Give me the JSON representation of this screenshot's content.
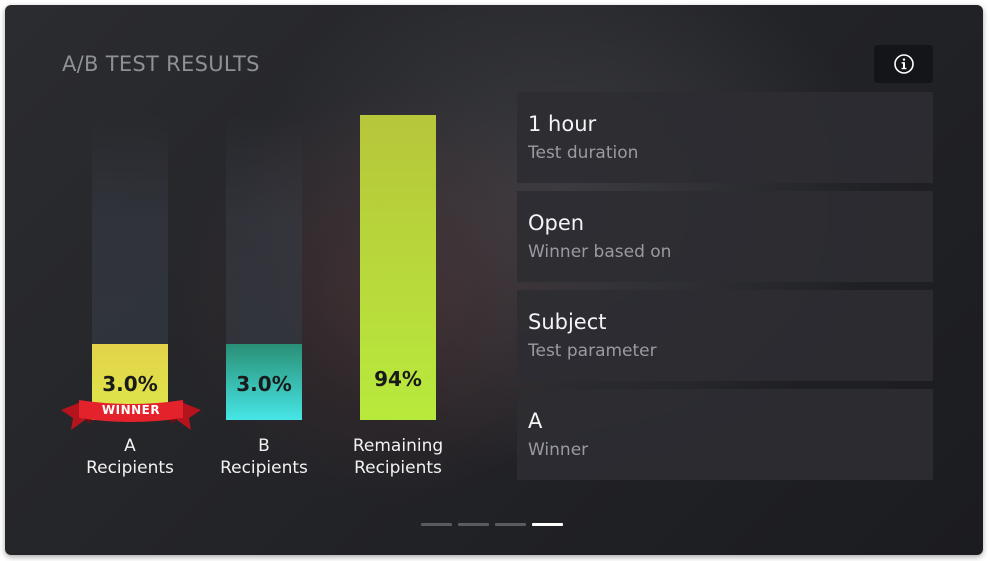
{
  "header": {
    "title": "A/B TEST RESULTS",
    "info_icon": "info-circle-icon"
  },
  "bars": [
    {
      "value": "3.0%",
      "fraction": 0.25,
      "label_line1": "A",
      "label_line2": "Recipients",
      "color_top": "#e3d24a",
      "color_bottom": "#dde84a"
    },
    {
      "value": "3.0%",
      "fraction": 0.25,
      "label_line1": "B",
      "label_line2": "Recipients",
      "color_top": "#2a8f76",
      "color_bottom": "#46e6e6"
    },
    {
      "value": "94%",
      "fraction": 1.0,
      "label_line1": "Remaining",
      "label_line2": "Recipients",
      "color_top": "#b7c63a",
      "color_bottom": "#b8ea3c"
    }
  ],
  "winner_badge": "WINNER",
  "cards": [
    {
      "value": "1 hour",
      "label": "Test duration"
    },
    {
      "value": "Open",
      "label": "Winner based on"
    },
    {
      "value": "Subject",
      "label": "Test parameter"
    },
    {
      "value": "A",
      "label": "Winner"
    }
  ],
  "pager": {
    "count": 4,
    "active_index": 3
  }
}
